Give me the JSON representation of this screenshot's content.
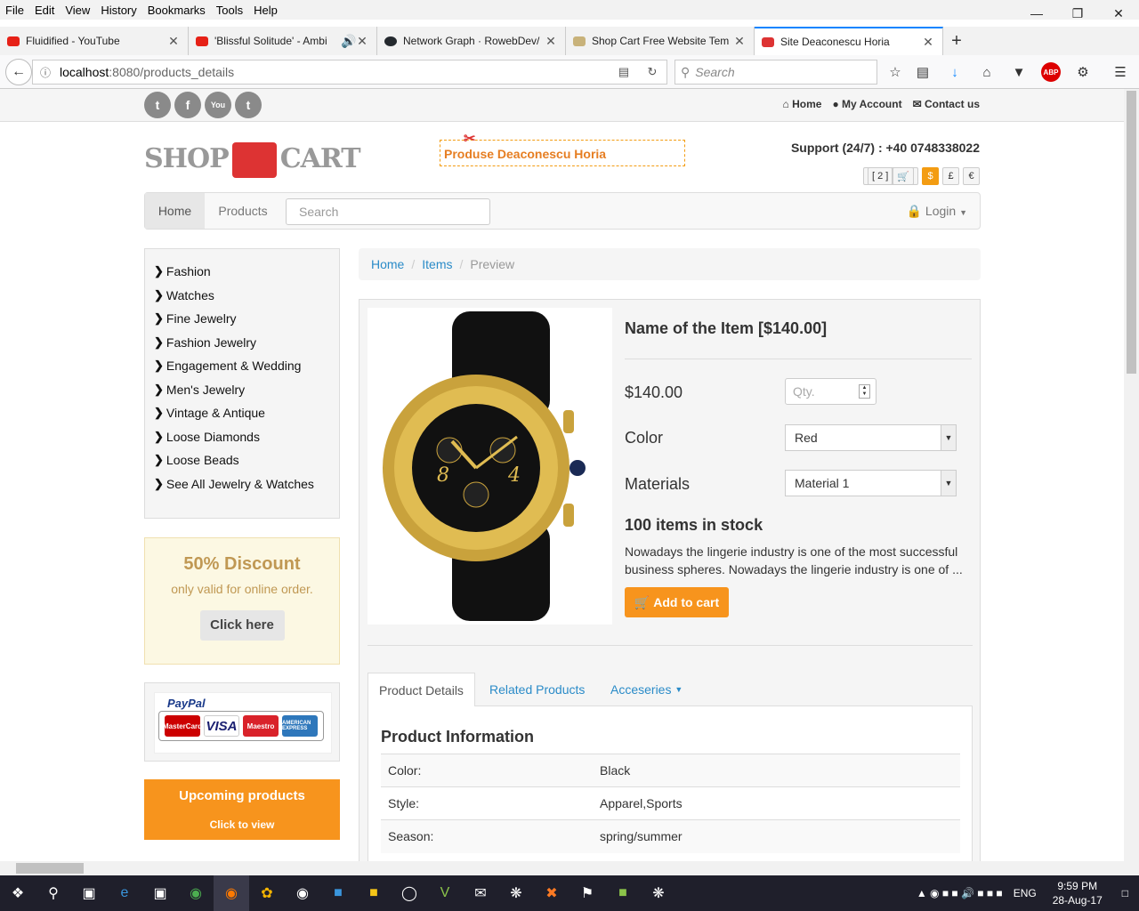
{
  "browser": {
    "menu": [
      "File",
      "Edit",
      "View",
      "History",
      "Bookmarks",
      "Tools",
      "Help"
    ],
    "tabs": [
      {
        "title": "Fluidified - YouTube",
        "color": "#e62117"
      },
      {
        "title": "'Blissful Solitude' - Ambi",
        "color": "#e62117"
      },
      {
        "title": "Network Graph · RowebDev/",
        "color": "#24292e"
      },
      {
        "title": "Shop Cart Free Website Tem",
        "color": "#c8b27a"
      },
      {
        "title": "Site Deaconescu Horia",
        "color": "#d33"
      }
    ],
    "url_host": "localhost",
    "url_path": ":8080/products_details",
    "search_placeholder": "Search"
  },
  "site": {
    "toplinks": {
      "home": "Home",
      "account": "My Account",
      "contact": "Contact us"
    },
    "logo_left": "SHOP",
    "logo_right": "CART",
    "promo": "Produse Deaconescu Horia",
    "support": "Support (24/7) : +40 0748338022",
    "cart_count": "[ 2 ]",
    "currencies": [
      "$",
      "£",
      "€"
    ],
    "nav": {
      "home": "Home",
      "products": "Products",
      "search_placeholder": "Search",
      "login": "Login"
    },
    "categories": [
      "Fashion",
      "Watches",
      "Fine Jewelry",
      "Fashion Jewelry",
      "Engagement & Wedding",
      "Men's Jewelry",
      "Vintage & Antique",
      "Loose Diamonds",
      "Loose Beads",
      "See All Jewelry & Watches"
    ],
    "discount": {
      "title": "50% Discount",
      "subtitle": "only valid for online order.",
      "button": "Click here"
    },
    "payment": {
      "paypal": "PayPal",
      "cards": [
        "MasterCard",
        "VISA",
        "Maestro",
        "AMERICAN EXPRESS"
      ]
    },
    "upcoming": {
      "title": "Upcoming products",
      "link": "Click to view"
    },
    "breadcrumb": [
      "Home",
      "Items",
      "Preview"
    ],
    "product": {
      "name": "Name of the Item [$140.00]",
      "price": "$140.00",
      "qty_placeholder": "Qty.",
      "color_label": "Color",
      "color_value": "Red",
      "materials_label": "Materials",
      "materials_value": "Material 1",
      "stock": "100 items in stock",
      "description": "Nowadays the lingerie industry is one of the most successful business spheres. Nowadays the lingerie industry is one of ...",
      "add_to_cart": "Add to cart"
    },
    "tabs": [
      "Product Details",
      "Related Products",
      "Acceseries"
    ],
    "info_title": "Product Information",
    "info_rows": [
      {
        "key": "Color:",
        "value": "Black"
      },
      {
        "key": "Style:",
        "value": "Apparel,Sports"
      },
      {
        "key": "Season:",
        "value": "spring/summer"
      }
    ]
  },
  "taskbar": {
    "lang": "ENG",
    "time": "9:59 PM",
    "date": "28-Aug-17"
  }
}
